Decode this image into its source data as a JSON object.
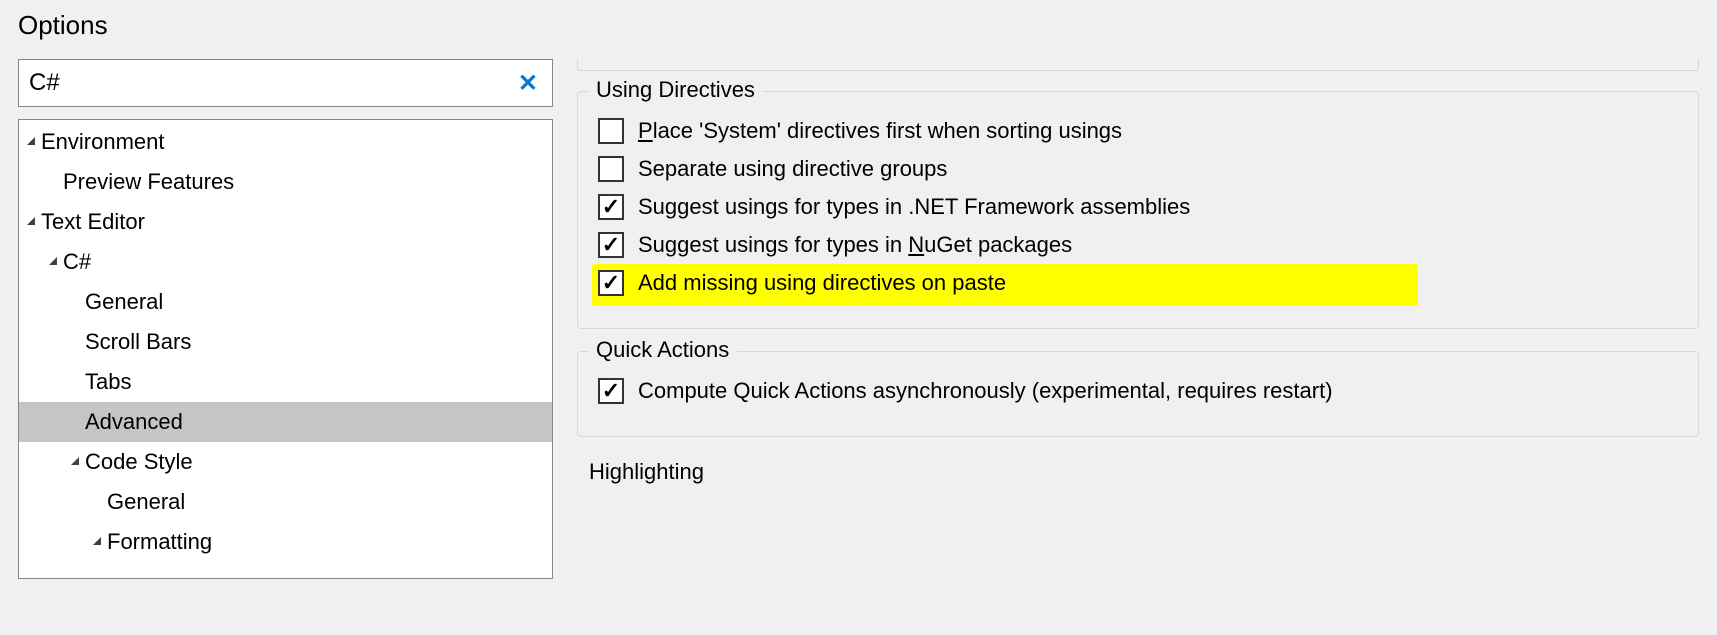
{
  "dialog": {
    "title": "Options"
  },
  "search": {
    "value": "C#"
  },
  "tree": [
    {
      "label": "Environment",
      "indent": 0,
      "expander": "▲",
      "selected": false
    },
    {
      "label": "Preview Features",
      "indent": 1,
      "expander": "",
      "selected": false
    },
    {
      "label": "Text Editor",
      "indent": 0,
      "expander": "▲",
      "selected": false
    },
    {
      "label": "C#",
      "indent": 1,
      "expander": "▲",
      "selected": false
    },
    {
      "label": "General",
      "indent": 2,
      "expander": "",
      "selected": false
    },
    {
      "label": "Scroll Bars",
      "indent": 2,
      "expander": "",
      "selected": false
    },
    {
      "label": "Tabs",
      "indent": 2,
      "expander": "",
      "selected": false
    },
    {
      "label": "Advanced",
      "indent": 2,
      "expander": "",
      "selected": true
    },
    {
      "label": "Code Style",
      "indent": 2,
      "expander": "▲",
      "selected": false
    },
    {
      "label": "General",
      "indent": 3,
      "expander": "",
      "selected": false
    },
    {
      "label": "Formatting",
      "indent": 3,
      "expander": "▲",
      "selected": false
    }
  ],
  "groups": {
    "usingDirectives": {
      "legend": "Using Directives",
      "items": [
        {
          "checked": false,
          "pre": "",
          "u": "P",
          "post": "lace 'System' directives first when sorting usings",
          "highlight": false
        },
        {
          "checked": false,
          "pre": "Separate using directive groups",
          "u": "",
          "post": "",
          "highlight": false
        },
        {
          "checked": true,
          "pre": "Suggest usings for types in .NET Framework assemblies",
          "u": "",
          "post": "",
          "highlight": false
        },
        {
          "checked": true,
          "pre": "Suggest usings for types in ",
          "u": "N",
          "post": "uGet packages",
          "highlight": false
        },
        {
          "checked": true,
          "pre": "Add missing using directives on paste",
          "u": "",
          "post": "",
          "highlight": true
        }
      ]
    },
    "quickActions": {
      "legend": "Quick Actions",
      "items": [
        {
          "checked": true,
          "pre": "Compute Quick Actions asynchronously (experimental, requires restart)",
          "u": "",
          "post": "",
          "highlight": false
        }
      ]
    },
    "highlighting": {
      "legend": "Highlighting"
    }
  }
}
